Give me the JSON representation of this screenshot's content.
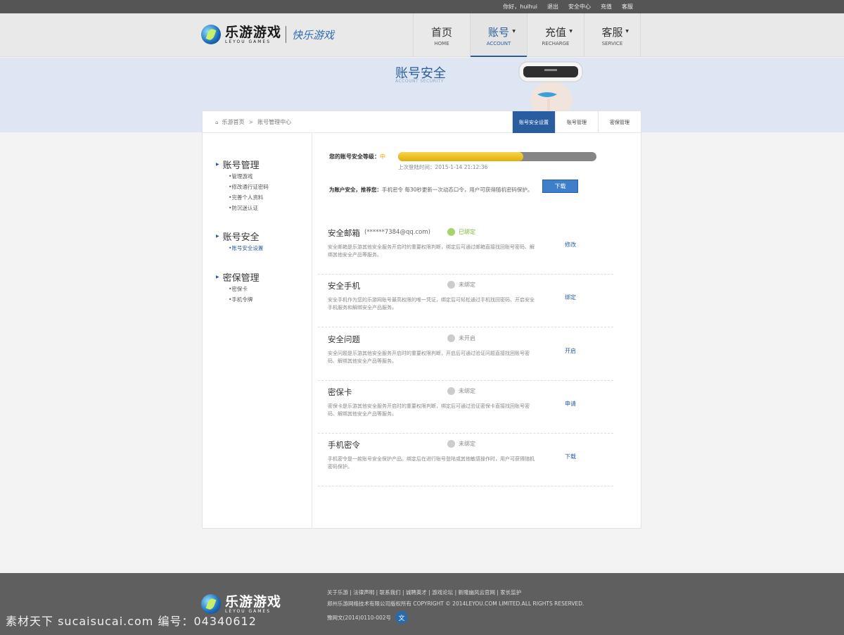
{
  "topbar": {
    "greeting": "你好，huihui",
    "logout": "退出",
    "security_center": "安全中心",
    "recharge": "充值",
    "service": "客服"
  },
  "logo": {
    "cn": "乐游游戏",
    "en": "LEYOU GAMES",
    "slogan": "快乐游戏"
  },
  "nav": [
    {
      "cn": "首页",
      "en": "HOME",
      "dropdown": false,
      "active": false
    },
    {
      "cn": "账号",
      "en": "ACCOUNT",
      "dropdown": true,
      "active": true
    },
    {
      "cn": "充值",
      "en": "RECHARGE",
      "dropdown": true,
      "active": false
    },
    {
      "cn": "客服",
      "en": "SERVICE",
      "dropdown": true,
      "active": false
    }
  ],
  "banner": {
    "title": "账号安全",
    "subtitle": "ACCOUNT SECURITY"
  },
  "breadcrumb": {
    "home": "乐游首页",
    "separator": ">",
    "current": "账号管理中心"
  },
  "tabs": [
    "账号安全设置",
    "账号管理",
    "密保管理"
  ],
  "sidebar": [
    {
      "title": "账号管理",
      "items": [
        "•管理游戏",
        "•修改通行证密码",
        "•完善个人资料",
        "•防沉迷认证"
      ]
    },
    {
      "title": "账号安全",
      "items": [
        "•账号安全设置"
      ]
    },
    {
      "title": "密保管理",
      "items": [
        "•密保卡",
        "•手机令牌"
      ]
    }
  ],
  "security": {
    "level_label": "您的账号安全等级：",
    "level_value": "中",
    "level_fraction": 0.63,
    "last_login": "上次登陆时间：2015-1-14 21:12:36",
    "recommend_bold": "为账户安全，推荐您：",
    "recommend_text": "手机密令 每30秒更新一次动态口令，用户可获得随机密码保护。",
    "download_button": "下载"
  },
  "items": [
    {
      "title": "安全邮箱",
      "extra": "(******7384@qq.com)",
      "status": "已绑定",
      "bound": true,
      "desc": "安全邮箱是乐游其他安全服务开启时的重要权限判断，绑定后可通过邮箱直接找回账号密码、解绑其他安全产品等服务。",
      "action": "修改"
    },
    {
      "title": "安全手机",
      "extra": "",
      "status": "未绑定",
      "bound": false,
      "desc": "安全手机作为您的乐游网账号最高权限的唯一凭证，绑定后可轻松通过手机找回密码、开启安全手机服务和解绑安全产品服务。",
      "action": "绑定"
    },
    {
      "title": "安全问题",
      "extra": "",
      "status": "未开启",
      "bound": false,
      "desc": "安全问题是乐游其他安全服务开启时的重要权限判断，开启后可通过验证问题直接找回账号密码、解绑其他安全产品等服务。",
      "action": "开启"
    },
    {
      "title": "密保卡",
      "extra": "",
      "status": "未绑定",
      "bound": false,
      "desc": "密保卡是乐游其他安全服务开启时的重要权限判断，绑定后可通过验证密保卡直接找回账号密码、解绑其他安全产品等服务。",
      "action": "申请"
    },
    {
      "title": "手机密令",
      "extra": "",
      "status": "未绑定",
      "bound": false,
      "desc": "手机密令是一款账号安全保护产品。绑定后在进行账号登陆或其他敏感操作时，用户可获得随机密码保护。",
      "action": "下载"
    }
  ],
  "footer": {
    "links": "关于乐游 | 法律声明 | 联系我们 | 诚聘英才 | 游戏论坛 | 新隆幽风云官网 | 家长监护",
    "copyright": "郑州乐游网络技术有限公司版权所有 COPYRIGHT © 2014LEYOU.COM LIMITED.ALL RIGHTS RESERVED.",
    "icp": "豫网文(2014)0110-002号"
  },
  "watermark": "素材天下 sucaisucai.com  编号：04340612"
}
